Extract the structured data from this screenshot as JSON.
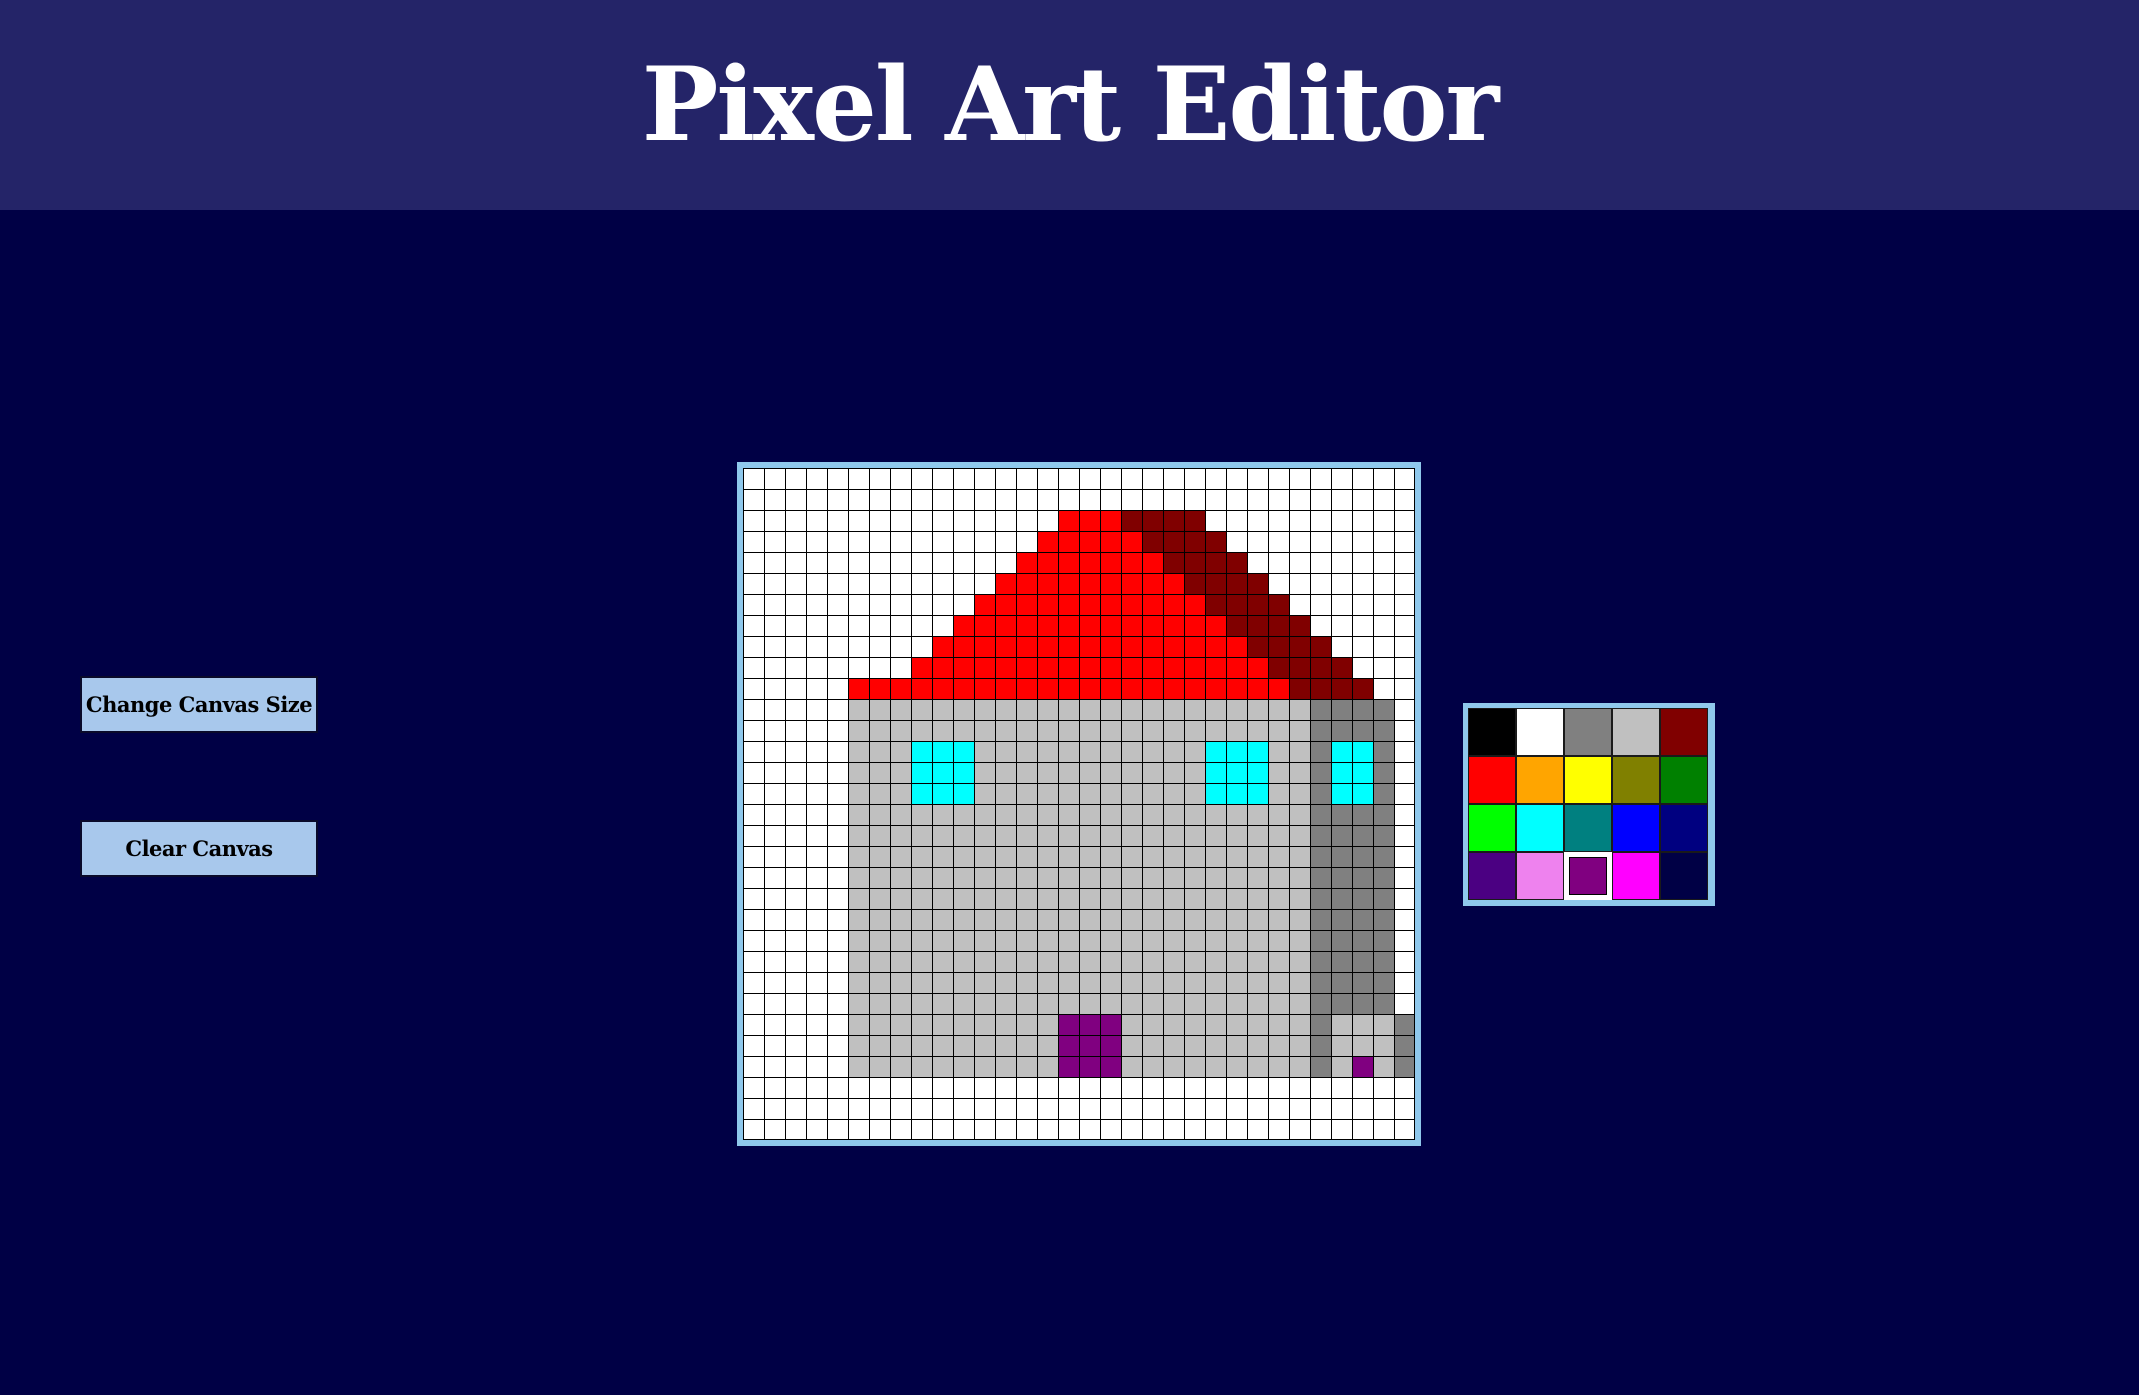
{
  "header": {
    "title": "Pixel Art Editor"
  },
  "controls": {
    "change_size_label": "Change Canvas Size",
    "clear_label": "Clear Canvas"
  },
  "colors": {
    "header_bg": "#242468",
    "page_bg": "#000045",
    "button_bg": "#a8c8ec",
    "frame_border": "#8fc8ec"
  },
  "palette": {
    "swatches": [
      "#000000",
      "#ffffff",
      "#808080",
      "#c0c0c0",
      "#800000",
      "#ff0000",
      "#ffa500",
      "#ffff00",
      "#808000",
      "#008000",
      "#00ff00",
      "#00ffff",
      "#008080",
      "#0000ff",
      "#000080",
      "#4b0082",
      "#ee82ee",
      "#800080",
      "#ff00ff",
      "#000045"
    ],
    "selected_index": 17
  },
  "canvas": {
    "size": 32,
    "legend": {
      ".": "#ffffff",
      "R": "#ff0000",
      "M": "#800000",
      "S": "#c0c0c0",
      "D": "#808080",
      "C": "#00ffff",
      "P": "#800080"
    },
    "rows": [
      "................................",
      "................................",
      "...............RRRMMMM..........",
      "..............RRRRRMMMM.........",
      ".............RRRRRRRMMMM........",
      "............RRRRRRRRRMMMM.......",
      "...........RRRRRRRRRRRMMMM......",
      "..........RRRRRRRRRRRRRMMMM.....",
      ".........RRRRRRRRRRRRRRRMMMM....",
      "........RRRRRRRRRRRRRRRRRMMMM...",
      ".....RRRRRRRRRRRRRRRRRRRRRMMMM..",
      ".....SSSSSSSSSSSSSSSSSSSSSSDDDD.",
      ".....SSSSSSSSSSSSSSSSSSSSSSDDDD.",
      ".....SSSCCCSSSSSSSSSSSCCCSSDCCD.",
      ".....SSSCCCSSSSSSSSSSSCCCSSDCCD.",
      ".....SSSCCCSSSSSSSSSSSCCCSSDCCD.",
      ".....SSSSSSSSSSSSSSSSSSSSSSDDDD.",
      ".....SSSSSSSSSSSSSSSSSSSSSSDDDD.",
      ".....SSSSSSSSSSSSSSSSSSSSSSDDDD.",
      ".....SSSSSSSSSSSSSSSSSSSSSSDDDD.",
      ".....SSSSSSSSSSSSSSSSSSSSSSDDDD.",
      ".....SSSSSSSSSSSSSSSSSSSSSSDDDD.",
      ".....SSSSSSSSSSSSSSSSSSSSSSDDDD.",
      ".....SSSSSSSSSSSSSSSSSSSSSSDDDD.",
      ".....SSSSSSSSSSSSSSSSSSSSSSDDDD.",
      ".....SSSSSSSSSSSSSSSSSSSSSSDDDD.",
      ".....SSSSSSSSSSPPPSSSSSSSSSDSSSD",
      ".....SSSSSSSSSSPPPSSSSSSSSSDSSSD",
      ".....SSSSSSSSSSPPPSSSSSSSSSDSPSD",
      "................................",
      "................................",
      "................................"
    ]
  }
}
